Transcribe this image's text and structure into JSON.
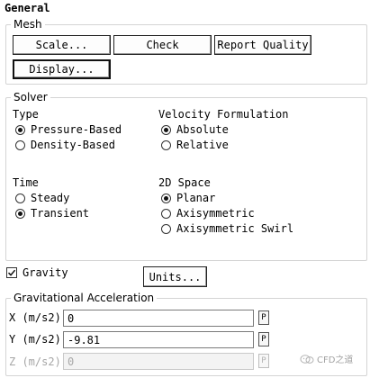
{
  "panel_title": "General",
  "mesh": {
    "legend": "Mesh",
    "scale_button": "Scale...",
    "check_button": "Check",
    "report_quality_button": "Report Quality",
    "display_button": "Display..."
  },
  "solver": {
    "legend": "Solver",
    "type": {
      "label": "Type",
      "options": [
        "Pressure-Based",
        "Density-Based"
      ],
      "selected": "Pressure-Based"
    },
    "velocity_formulation": {
      "label": "Velocity Formulation",
      "options": [
        "Absolute",
        "Relative"
      ],
      "selected": "Absolute"
    },
    "time": {
      "label": "Time",
      "options": [
        "Steady",
        "Transient"
      ],
      "selected": "Transient"
    },
    "space_2d": {
      "label": "2D Space",
      "options": [
        "Planar",
        "Axisymmetric",
        "Axisymmetric Swirl"
      ],
      "selected": "Planar"
    }
  },
  "gravity": {
    "label": "Gravity",
    "checked": true,
    "units_button": "Units..."
  },
  "gravitational_acceleration": {
    "legend": "Gravitational Acceleration",
    "x": {
      "label": "X (m/s2)",
      "value": "0",
      "p": "P"
    },
    "y": {
      "label": "Y (m/s2)",
      "value": "-9.81",
      "p": "P"
    },
    "z": {
      "label": "Z (m/s2)",
      "value": "0",
      "p": "P"
    }
  },
  "watermark": "CFD之道"
}
